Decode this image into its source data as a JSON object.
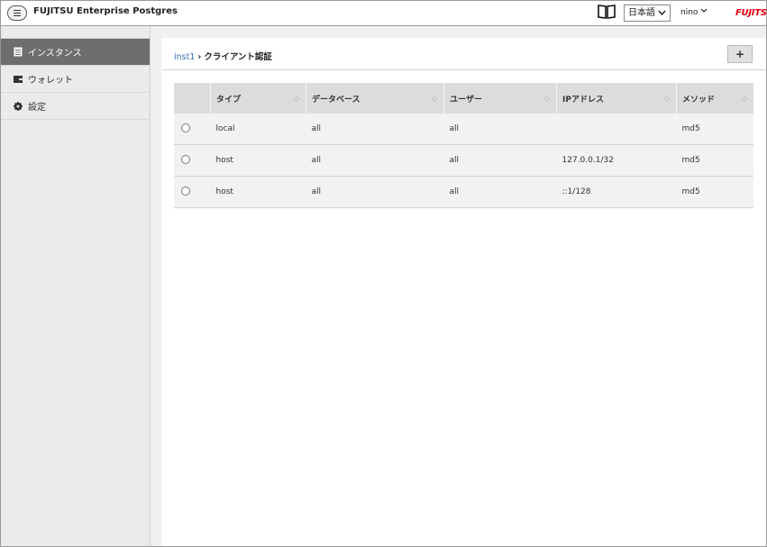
{
  "header": {
    "app_title": "FUJITSU Enterprise Postgres",
    "language": "日本語",
    "user": "nino",
    "brand": "FUJITSU"
  },
  "sidebar": {
    "items": [
      {
        "label": "インスタンス",
        "icon": "database-icon",
        "active": true
      },
      {
        "label": "ウォレット",
        "icon": "wallet-icon",
        "active": false
      },
      {
        "label": "設定",
        "icon": "gear-icon",
        "active": false
      }
    ]
  },
  "breadcrumb": {
    "parent": "inst1",
    "current": "クライアント認証"
  },
  "toolbar": {
    "add_label": "+"
  },
  "table": {
    "columns": [
      "タイプ",
      "データベース",
      "ユーザー",
      "IPアドレス",
      "メソッド"
    ],
    "rows": [
      [
        "local",
        "all",
        "all",
        "",
        "md5"
      ],
      [
        "host",
        "all",
        "all",
        "127.0.0.1/32",
        "md5"
      ],
      [
        "host",
        "all",
        "all",
        "::1/128",
        "md5"
      ]
    ]
  },
  "colors": {
    "accent_link": "#3a6fb0",
    "brand_red": "#e60012",
    "sidebar_active": "#6e6e6e"
  }
}
